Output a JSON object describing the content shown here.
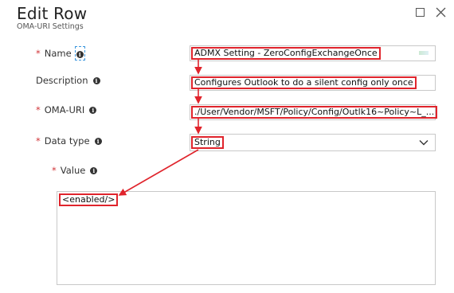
{
  "header": {
    "title": "Edit Row",
    "subtitle": "OMA-URI Settings"
  },
  "form": {
    "name": {
      "label": "Name",
      "required": "*",
      "value": "ADMX Setting - ZeroConfigExchangeOnce"
    },
    "description": {
      "label": "Description",
      "value": "Configures Outlook to do a silent config only once"
    },
    "oma_uri": {
      "label": "OMA-URI",
      "required": "*",
      "value": "./User/Vendor/MSFT/Policy/Config/Outlk16~Policy~L_..."
    },
    "data_type": {
      "label": "Data type",
      "required": "*",
      "value": "String"
    },
    "value": {
      "label": "Value",
      "required": "*",
      "value": "<enabled/>"
    }
  },
  "icons": [
    "maximize-icon",
    "close-icon",
    "info-icon",
    "chevron-down-icon",
    "arrow-annotation"
  ],
  "colors": {
    "highlight": "#e0242c",
    "required": "#d13438"
  }
}
